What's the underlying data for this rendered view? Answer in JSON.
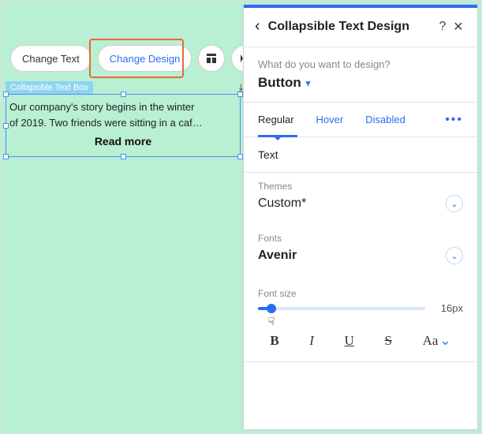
{
  "toolbar": {
    "change_text": "Change Text",
    "change_design": "Change Design"
  },
  "box": {
    "label": "Collapsible Text Box",
    "line1": "Our company's story begins in the winter",
    "line2": "of 2019. Two friends were sitting in a caf…",
    "read_more": "Read more"
  },
  "panel": {
    "title": "Collapsible Text Design",
    "design_question": "What do you want to design?",
    "design_value": "Button",
    "tabs": {
      "regular": "Regular",
      "hover": "Hover",
      "disabled": "Disabled"
    },
    "text_header": "Text",
    "themes": {
      "label": "Themes",
      "value": "Custom*"
    },
    "fonts": {
      "label": "Fonts",
      "value": "Avenir"
    },
    "fontsize": {
      "label": "Font size",
      "value": "16px"
    },
    "format": {
      "aa": "Aa"
    }
  }
}
